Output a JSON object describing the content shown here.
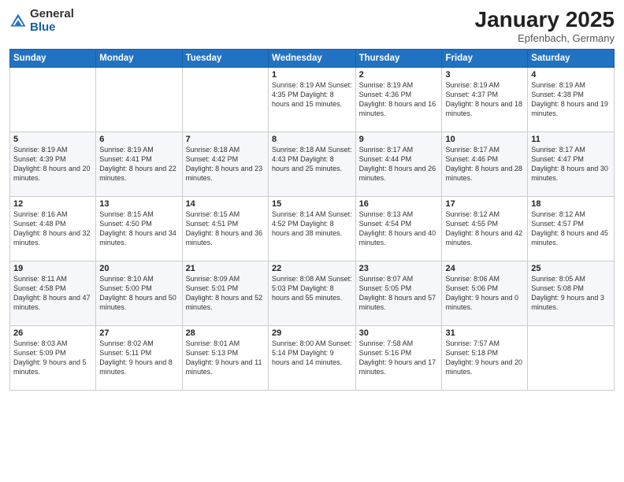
{
  "logo": {
    "general": "General",
    "blue": "Blue"
  },
  "header": {
    "month": "January 2025",
    "location": "Epfenbach, Germany"
  },
  "days_of_week": [
    "Sunday",
    "Monday",
    "Tuesday",
    "Wednesday",
    "Thursday",
    "Friday",
    "Saturday"
  ],
  "weeks": [
    [
      {
        "day": "",
        "info": ""
      },
      {
        "day": "",
        "info": ""
      },
      {
        "day": "",
        "info": ""
      },
      {
        "day": "1",
        "info": "Sunrise: 8:19 AM\nSunset: 4:35 PM\nDaylight: 8 hours\nand 15 minutes."
      },
      {
        "day": "2",
        "info": "Sunrise: 8:19 AM\nSunset: 4:36 PM\nDaylight: 8 hours\nand 16 minutes."
      },
      {
        "day": "3",
        "info": "Sunrise: 8:19 AM\nSunset: 4:37 PM\nDaylight: 8 hours\nand 18 minutes."
      },
      {
        "day": "4",
        "info": "Sunrise: 8:19 AM\nSunset: 4:38 PM\nDaylight: 8 hours\nand 19 minutes."
      }
    ],
    [
      {
        "day": "5",
        "info": "Sunrise: 8:19 AM\nSunset: 4:39 PM\nDaylight: 8 hours\nand 20 minutes."
      },
      {
        "day": "6",
        "info": "Sunrise: 8:19 AM\nSunset: 4:41 PM\nDaylight: 8 hours\nand 22 minutes."
      },
      {
        "day": "7",
        "info": "Sunrise: 8:18 AM\nSunset: 4:42 PM\nDaylight: 8 hours\nand 23 minutes."
      },
      {
        "day": "8",
        "info": "Sunrise: 8:18 AM\nSunset: 4:43 PM\nDaylight: 8 hours\nand 25 minutes."
      },
      {
        "day": "9",
        "info": "Sunrise: 8:17 AM\nSunset: 4:44 PM\nDaylight: 8 hours\nand 26 minutes."
      },
      {
        "day": "10",
        "info": "Sunrise: 8:17 AM\nSunset: 4:46 PM\nDaylight: 8 hours\nand 28 minutes."
      },
      {
        "day": "11",
        "info": "Sunrise: 8:17 AM\nSunset: 4:47 PM\nDaylight: 8 hours\nand 30 minutes."
      }
    ],
    [
      {
        "day": "12",
        "info": "Sunrise: 8:16 AM\nSunset: 4:48 PM\nDaylight: 8 hours\nand 32 minutes."
      },
      {
        "day": "13",
        "info": "Sunrise: 8:15 AM\nSunset: 4:50 PM\nDaylight: 8 hours\nand 34 minutes."
      },
      {
        "day": "14",
        "info": "Sunrise: 8:15 AM\nSunset: 4:51 PM\nDaylight: 8 hours\nand 36 minutes."
      },
      {
        "day": "15",
        "info": "Sunrise: 8:14 AM\nSunset: 4:52 PM\nDaylight: 8 hours\nand 38 minutes."
      },
      {
        "day": "16",
        "info": "Sunrise: 8:13 AM\nSunset: 4:54 PM\nDaylight: 8 hours\nand 40 minutes."
      },
      {
        "day": "17",
        "info": "Sunrise: 8:12 AM\nSunset: 4:55 PM\nDaylight: 8 hours\nand 42 minutes."
      },
      {
        "day": "18",
        "info": "Sunrise: 8:12 AM\nSunset: 4:57 PM\nDaylight: 8 hours\nand 45 minutes."
      }
    ],
    [
      {
        "day": "19",
        "info": "Sunrise: 8:11 AM\nSunset: 4:58 PM\nDaylight: 8 hours\nand 47 minutes."
      },
      {
        "day": "20",
        "info": "Sunrise: 8:10 AM\nSunset: 5:00 PM\nDaylight: 8 hours\nand 50 minutes."
      },
      {
        "day": "21",
        "info": "Sunrise: 8:09 AM\nSunset: 5:01 PM\nDaylight: 8 hours\nand 52 minutes."
      },
      {
        "day": "22",
        "info": "Sunrise: 8:08 AM\nSunset: 5:03 PM\nDaylight: 8 hours\nand 55 minutes."
      },
      {
        "day": "23",
        "info": "Sunrise: 8:07 AM\nSunset: 5:05 PM\nDaylight: 8 hours\nand 57 minutes."
      },
      {
        "day": "24",
        "info": "Sunrise: 8:06 AM\nSunset: 5:06 PM\nDaylight: 9 hours\nand 0 minutes."
      },
      {
        "day": "25",
        "info": "Sunrise: 8:05 AM\nSunset: 5:08 PM\nDaylight: 9 hours\nand 3 minutes."
      }
    ],
    [
      {
        "day": "26",
        "info": "Sunrise: 8:03 AM\nSunset: 5:09 PM\nDaylight: 9 hours\nand 5 minutes."
      },
      {
        "day": "27",
        "info": "Sunrise: 8:02 AM\nSunset: 5:11 PM\nDaylight: 9 hours\nand 8 minutes."
      },
      {
        "day": "28",
        "info": "Sunrise: 8:01 AM\nSunset: 5:13 PM\nDaylight: 9 hours\nand 11 minutes."
      },
      {
        "day": "29",
        "info": "Sunrise: 8:00 AM\nSunset: 5:14 PM\nDaylight: 9 hours\nand 14 minutes."
      },
      {
        "day": "30",
        "info": "Sunrise: 7:58 AM\nSunset: 5:16 PM\nDaylight: 9 hours\nand 17 minutes."
      },
      {
        "day": "31",
        "info": "Sunrise: 7:57 AM\nSunset: 5:18 PM\nDaylight: 9 hours\nand 20 minutes."
      },
      {
        "day": "",
        "info": ""
      }
    ]
  ]
}
